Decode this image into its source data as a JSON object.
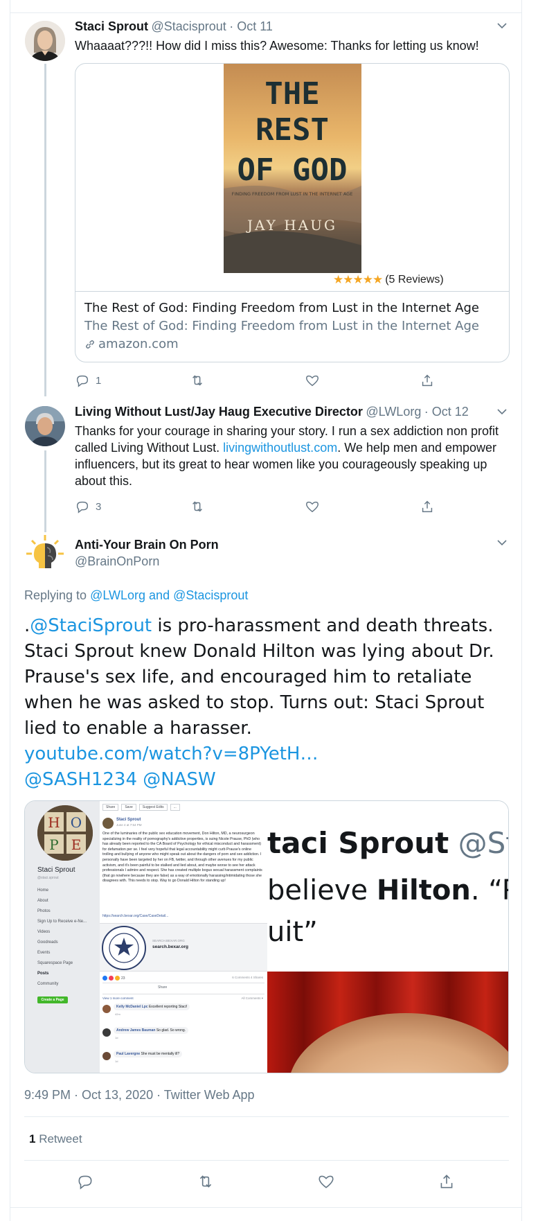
{
  "tweet1": {
    "display_name": "Staci Sprout",
    "handle": "@Stacisprout",
    "date": "· Oct 11",
    "text": "Whaaaat???!! How did I miss this? Awesome: Thanks for letting us know!",
    "card": {
      "book_title_line1": "THE",
      "book_title_line2": "REST",
      "book_title_line3": "OF GOD",
      "book_subtitle": "FINDING FREEDOM FROM LUST IN THE INTERNET AGE",
      "book_author": "JAY HAUG",
      "reviews": "(5 Reviews)",
      "title": "The Rest of God: Finding Freedom from Lust in the Internet Age",
      "description": "The Rest of God: Finding Freedom from Lust in the Internet Age",
      "domain": "amazon.com"
    },
    "reply_count": "1"
  },
  "tweet2": {
    "display_name": "Living Without Lust/Jay Haug Executive Director",
    "handle": "@LWLorg",
    "date": "· Oct 12",
    "text_before": "Thanks for your courage in sharing your story. I run a sex addiction non profit called Living Without Lust.",
    "link": "livingwithoutlust.com",
    "text_after": ".  We help men and empower influencers, but its great to hear women like you courageously speaking up about this.",
    "reply_count": "3"
  },
  "main": {
    "display_name": "Anti-Your Brain On Porn",
    "handle": "@BrainOnPorn",
    "replying_prefix": "Replying to",
    "replying_to": "@LWLorg and @Stacisprout",
    "text_prefix": ".",
    "mention": "@StaciSprout",
    "text_body": " is pro-harassment and death threats. Staci Sprout knew Donald Hilton was lying about Dr. Prause's sex life, and encouraged him to retaliate when he was asked to stop. Turns out: Staci Sprout lied to enable a harasser.",
    "youtube": "youtube.com/watch?v=8PYetH…",
    "tags": "@SASH1234 @NASW",
    "timestamp": "9:49 PM · Oct 13, 2020 · Twitter Web App",
    "retweet_count": "1",
    "retweet_label": "Retweet"
  },
  "media": {
    "fb_profile_name": "Staci Sprout",
    "fb_profile_handle": "@staci.sprout",
    "fb_nav": [
      "Home",
      "About",
      "Photos",
      "Sign Up to Receive e-Ne...",
      "Videos",
      "Goodreads",
      "Events",
      "Squarespace Page",
      "Posts",
      "Community"
    ],
    "fb_create_page": "Create a Page",
    "fb_toolbar": [
      "Share",
      "Save",
      "Suggest Edits",
      "..."
    ],
    "fb_post_author": "Staci Sprout",
    "fb_post_date": "June 4 at 7:54 PM",
    "fb_post_text": "One of the luminaries of the public sex education movement, Don Hilton, MD, a neurosurgeon specializing in the reality of pornography's addictive properties, is suing Nicole Prause, PhD (who has already been reported to the CA Board of Psychology for ethical misconduct and harassment) for defamation per se. I feel very hopeful that legal accountability might curb Prause's online trolling and bullying of anyone who might speak out about the dangers of porn and sex addiction. I personally have been targeted by her on FB, twitter, and through other avenues for my public activism, and it's been painful to be stalked and lied about, and maybe worse to see her attack professionals I admire and respect. She has created multiple bogus sexual harassment complaints (that go nowhere because they are false) as a way of emotionally harassing/intimidating those she disagrees with. This needs to stop. Way to go Donald Hilton for standing up!",
    "fb_post_link": "https://search.bexar.org/Case/CaseDetail...",
    "fb_link_domain": "SEARCH.BEXAR.ORG",
    "fb_link_title": "search.bexar.org",
    "fb_reactions": "23",
    "fb_comments": "6 Comments  4 Shares",
    "fb_share": "Share",
    "fb_view_more": "View 1 more comment",
    "fb_all_comments": "All Comments ▾",
    "fb_comments_list": [
      {
        "name": "Kelly McDaniel Lpc",
        "text": "Excellent reporting Staci!",
        "time": "42m"
      },
      {
        "name": "Andrew James Bauman",
        "text": "So glad. So wrong.",
        "time": "1d"
      },
      {
        "name": "Paul Lavergne",
        "text": "She must be mentally ill?",
        "time": "1d"
      }
    ],
    "seal_text": "THE STATE OF TEXAS · COUNTY OF BEXAR",
    "zoom_name": "taci Sprout",
    "zoom_handle": "@Sta",
    "zoom_line2a": "believe ",
    "zoom_line2b": "Hilton",
    "zoom_line2c": ". “P",
    "zoom_line3": "uit”",
    "hope_letters": [
      "H",
      "O",
      "P",
      "E"
    ]
  }
}
